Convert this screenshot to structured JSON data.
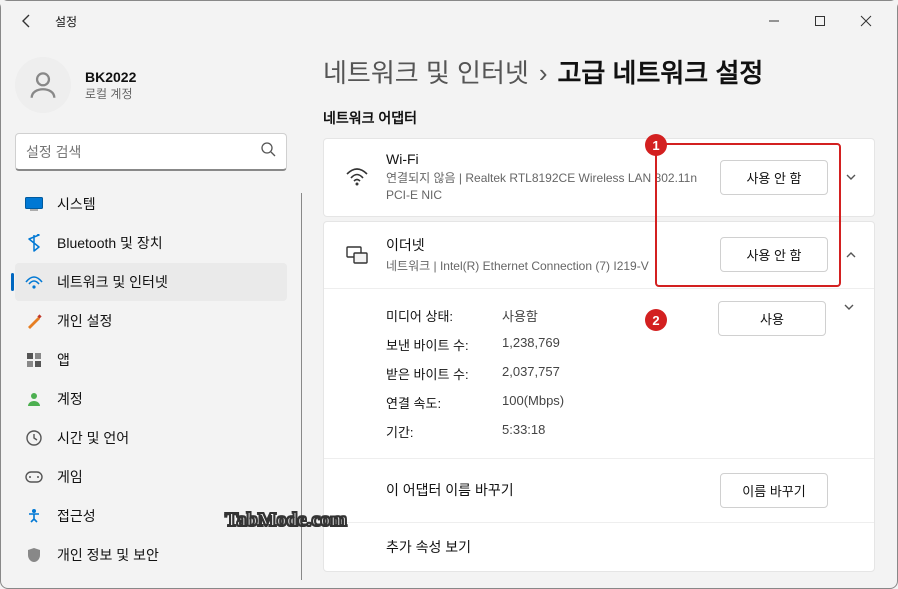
{
  "window": {
    "title": "설정"
  },
  "user": {
    "name": "BK2022",
    "account_type": "로컬 계정"
  },
  "search": {
    "placeholder": "설정 검색"
  },
  "sidebar": {
    "items": [
      {
        "label": "시스템",
        "icon": "system"
      },
      {
        "label": "Bluetooth 및 장치",
        "icon": "bluetooth"
      },
      {
        "label": "네트워크 및 인터넷",
        "icon": "network",
        "active": true
      },
      {
        "label": "개인 설정",
        "icon": "personalization"
      },
      {
        "label": "앱",
        "icon": "apps"
      },
      {
        "label": "계정",
        "icon": "accounts"
      },
      {
        "label": "시간 및 언어",
        "icon": "time"
      },
      {
        "label": "게임",
        "icon": "gaming"
      },
      {
        "label": "접근성",
        "icon": "accessibility"
      },
      {
        "label": "개인 정보 및 보안",
        "icon": "privacy"
      }
    ]
  },
  "breadcrumb": {
    "parent": "네트워크 및 인터넷",
    "sep": "›",
    "current": "고급 네트워크 설정"
  },
  "section_title": "네트워크 어댑터",
  "wifi": {
    "title": "Wi-Fi",
    "sub": "연결되지 않음 | Realtek RTL8192CE Wireless LAN 802.11n PCI-E NIC",
    "button": "사용 안 함"
  },
  "ethernet": {
    "title": "이더넷",
    "sub": "네트워크 | Intel(R) Ethernet Connection (7) I219-V",
    "button": "사용 안 함",
    "use_button": "사용",
    "details": {
      "media_state_label": "미디어 상태:",
      "media_state_value": "사용함",
      "sent_label": "보낸 바이트 수:",
      "sent_value": "1,238,769",
      "recv_label": "받은 바이트 수:",
      "recv_value": "2,037,757",
      "speed_label": "연결 속도:",
      "speed_value": "100(Mbps)",
      "duration_label": "기간:",
      "duration_value": "5:33:18"
    },
    "rename_label": "이 어댑터 이름 바꾸기",
    "rename_button": "이름 바꾸기",
    "more_label": "추가 속성 보기"
  },
  "annotations": {
    "one": "1",
    "two": "2"
  },
  "watermark": "TabMode.com"
}
